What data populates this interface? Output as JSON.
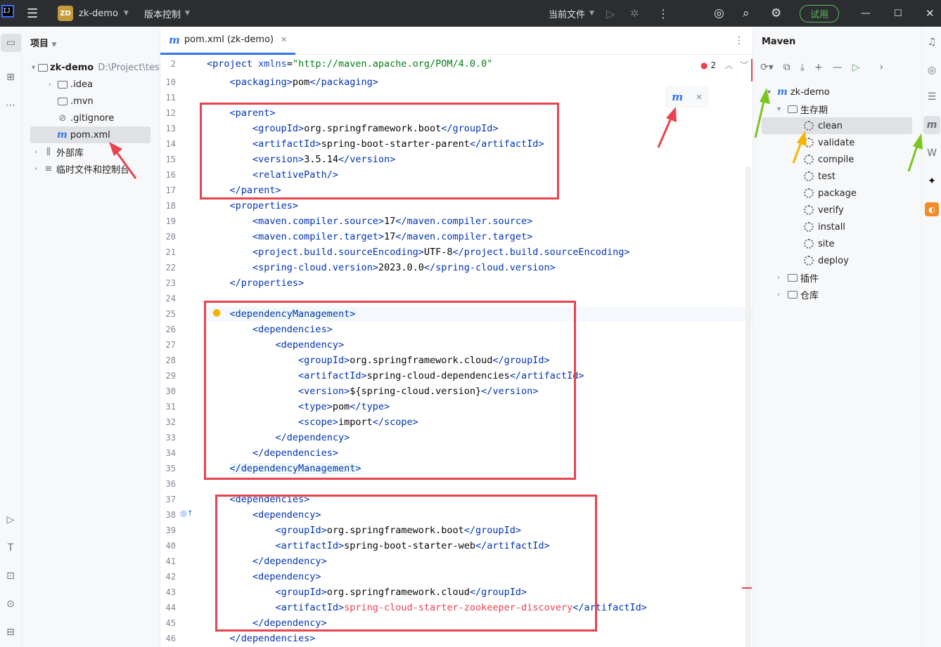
{
  "titlebar": {
    "project_badge": "ZD",
    "project_name": "zk-demo",
    "vcs": "版本控制",
    "run_config": "当前文件",
    "trial": "试用"
  },
  "project_panel": {
    "title": "项目",
    "items": [
      {
        "label": "zk-demo",
        "path": "D:\\Project\\test",
        "kind": "module"
      },
      {
        "label": ".idea",
        "kind": "folder"
      },
      {
        "label": ".mvn",
        "kind": "folder"
      },
      {
        "label": ".gitignore",
        "kind": "file"
      },
      {
        "label": "pom.xml",
        "kind": "maven"
      },
      {
        "label": "外部库",
        "kind": "lib"
      },
      {
        "label": "临时文件和控制台",
        "kind": "scratch"
      }
    ]
  },
  "editor": {
    "tab_label": "pom.xml (zk-demo)",
    "error_count": "2",
    "lines": [
      {
        "n": "2",
        "html": "<span class=\"t\">&lt;project</span> <span class=\"an\">xmlns</span>=<span class=\"av\">\"http://maven.apache.org/POM/4.0.0\"</span>"
      },
      {
        "n": "10",
        "html": "    <span class=\"t\">&lt;packaging&gt;</span>pom<span class=\"t\">&lt;/packaging&gt;</span>"
      },
      {
        "n": "11",
        "html": ""
      },
      {
        "n": "12",
        "html": "    <span class=\"t\">&lt;parent&gt;</span>"
      },
      {
        "n": "13",
        "html": "        <span class=\"t\">&lt;groupId&gt;</span>org.springframework.boot<span class=\"t\">&lt;/groupId&gt;</span>"
      },
      {
        "n": "14",
        "html": "        <span class=\"t\">&lt;artifactId&gt;</span>spring-boot-starter-parent<span class=\"t\">&lt;/artifactId&gt;</span>"
      },
      {
        "n": "15",
        "html": "        <span class=\"t\">&lt;version&gt;</span>3.5.14<span class=\"t\">&lt;/version&gt;</span>"
      },
      {
        "n": "16",
        "html": "        <span class=\"t\">&lt;relativePath/&gt;</span>"
      },
      {
        "n": "17",
        "html": "    <span class=\"t\">&lt;/parent&gt;</span>"
      },
      {
        "n": "18",
        "html": "    <span class=\"t\">&lt;properties&gt;</span>"
      },
      {
        "n": "19",
        "html": "        <span class=\"t\">&lt;maven.compiler.source&gt;</span>17<span class=\"t\">&lt;/maven.compiler.source&gt;</span>"
      },
      {
        "n": "20",
        "html": "        <span class=\"t\">&lt;maven.compiler.target&gt;</span>17<span class=\"t\">&lt;/maven.compiler.target&gt;</span>"
      },
      {
        "n": "21",
        "html": "        <span class=\"t\">&lt;project.build.sourceEncoding&gt;</span>UTF-8<span class=\"t\">&lt;/project.build.sourceEncoding&gt;</span>"
      },
      {
        "n": "22",
        "html": "        <span class=\"t\">&lt;spring-cloud.version&gt;</span>2023.0.0<span class=\"t\">&lt;/spring-cloud.version&gt;</span>"
      },
      {
        "n": "23",
        "html": "    <span class=\"t\">&lt;/properties&gt;</span>"
      },
      {
        "n": "24",
        "html": ""
      },
      {
        "n": "25",
        "html": "    <span class=\"t hl\">&lt;dependencyManagement&gt;</span>"
      },
      {
        "n": "26",
        "html": "        <span class=\"t\">&lt;dependencies&gt;</span>"
      },
      {
        "n": "27",
        "html": "            <span class=\"t\">&lt;dependency&gt;</span>"
      },
      {
        "n": "28",
        "html": "                <span class=\"t\">&lt;groupId&gt;</span>org.springframework.cloud<span class=\"t\">&lt;/groupId&gt;</span>"
      },
      {
        "n": "29",
        "html": "                <span class=\"t\">&lt;artifactId&gt;</span>spring-cloud-dependencies<span class=\"t\">&lt;/artifactId&gt;</span>"
      },
      {
        "n": "30",
        "html": "                <span class=\"t\">&lt;version&gt;</span>${spring-cloud.version}<span class=\"t\">&lt;/version&gt;</span>"
      },
      {
        "n": "31",
        "html": "                <span class=\"t\">&lt;type&gt;</span>pom<span class=\"t\">&lt;/type&gt;</span>"
      },
      {
        "n": "32",
        "html": "                <span class=\"t\">&lt;scope&gt;</span>import<span class=\"t\">&lt;/scope&gt;</span>"
      },
      {
        "n": "33",
        "html": "            <span class=\"t\">&lt;/dependency&gt;</span>"
      },
      {
        "n": "34",
        "html": "        <span class=\"t\">&lt;/dependencies&gt;</span>"
      },
      {
        "n": "35",
        "html": "    <span class=\"t hl\">&lt;/dependencyManagement&gt;</span>"
      },
      {
        "n": "36",
        "html": ""
      },
      {
        "n": "37",
        "html": "    <span class=\"t\">&lt;dependencies&gt;</span>"
      },
      {
        "n": "38",
        "html": "        <span class=\"t\">&lt;dependency&gt;</span>"
      },
      {
        "n": "39",
        "html": "            <span class=\"t\">&lt;groupId&gt;</span>org.springframework.boot<span class=\"t\">&lt;/groupId&gt;</span>"
      },
      {
        "n": "40",
        "html": "            <span class=\"t\">&lt;artifactId&gt;</span>spring-boot-starter-web<span class=\"t\">&lt;/artifactId&gt;</span>"
      },
      {
        "n": "41",
        "html": "        <span class=\"t\">&lt;/dependency&gt;</span>"
      },
      {
        "n": "42",
        "html": "        <span class=\"t\">&lt;dependency&gt;</span>"
      },
      {
        "n": "43",
        "html": "            <span class=\"t\">&lt;groupId&gt;</span>org.springframework.cloud<span class=\"t\">&lt;/groupId&gt;</span>"
      },
      {
        "n": "44",
        "html": "            <span class=\"t\">&lt;artifactId&gt;</span><span style=\"color:#e8434e\">spring-cloud-starter-zookeeper-discovery</span><span class=\"t\">&lt;/artifactId&gt;</span>"
      },
      {
        "n": "45",
        "html": "        <span class=\"t\">&lt;/dependency&gt;</span>"
      },
      {
        "n": "46",
        "html": "    <span class=\"t\">&lt;/dependencies&gt;</span>"
      }
    ]
  },
  "maven": {
    "title": "Maven",
    "project": "zk-demo",
    "lifecycle": "生存期",
    "goals": [
      "clean",
      "validate",
      "compile",
      "test",
      "package",
      "verify",
      "install",
      "site",
      "deploy"
    ],
    "plugins": "插件",
    "repos": "仓库"
  }
}
